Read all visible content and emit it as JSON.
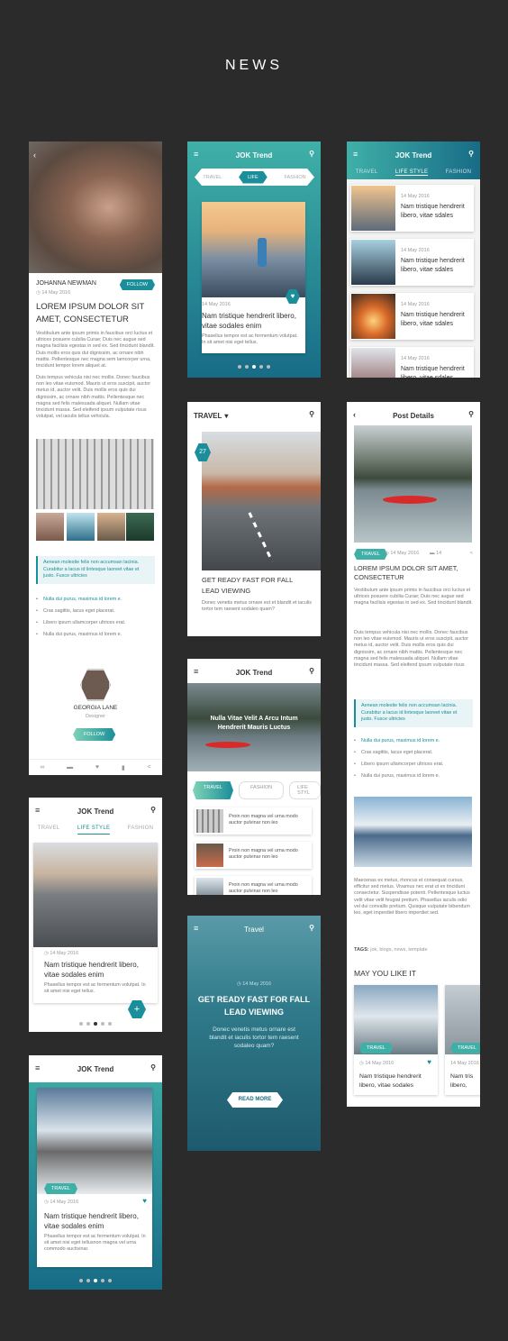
{
  "page": {
    "title": "NEWS"
  },
  "colors": {
    "accent": "#1a8e9a",
    "bg": "#2b2b2b"
  },
  "s1": {
    "author": "JOHANNA NEWMAN",
    "follow": "FOLLOW",
    "date": "14 May 2016",
    "title": "LOREM IPSUM DOLOR SIT AMET, CONSECTETUR",
    "p1": "Vestibulum ante ipsum primis in faucibus orci luctus et ultrices posuere cubilia Curae; Duis nec augue sed magna facilisis egestas in sed ex. Sed tincidunt blandit. Duis mollis eros quis dui dignissim, ac ornare nibh mattis. Pellentesque nec magna sem lamcorper urna, tincidunt tempor lorem aliquet at.",
    "p2": "Duis tempus vehicula nisi nec mollis. Donec faucibus non leo vitae euismod. Mauris ut eros suscipit, auctor metus id, auctor velit. Duis mollis eros quis dui dignissim, ac ornare nibh mattis. Pellentesque nec magna sed felis malesuada aliquet. Nullam vitae tincidunt massa. Sed eleifend ipsum vulputate risus volutpat, vel iaculis tellus vehicula.",
    "quote": "Aenean molestie felis non accumsan lacinia. Curabitur a lacus id lintesque laoreet vitae et justo. Fusce ultricies",
    "bullets": [
      "Nulla dui purus, maximus id lorem e.",
      "Cras sagittis, lacus eget placerat.",
      "Libero ipsum ullamcorper ultrices erat.",
      "Nulla dui purus, maximus id lorem e."
    ],
    "person": "GEORGIA LANE",
    "role": "Designer",
    "follow2": "FOLLOW"
  },
  "s2": {
    "title": "JOK Trend",
    "tabs": [
      "TRAVEL",
      "LIFE",
      "FASHION"
    ],
    "date": "14 May 2016",
    "headline": "Nam tristique hendrerit libero, vitae sodales enim",
    "body": "Phasellus tempor est ac fermentum volutpat. In sit amet nisi eget tellus."
  },
  "s3": {
    "title": "JOK Trend",
    "tabs": [
      "TRAVEL",
      "LIFE STYLE",
      "FASHION"
    ],
    "date": "14 May 2016",
    "headline": "Nam tristique hendrerit libero, vitae sdales"
  },
  "s4": {
    "title": "TRAVEL",
    "badge": "27",
    "headline": "GET READY FAST FOR FALL LEAD VIEWING",
    "body": "Donec venetis metus ornare est et blandit et iaculis tortor tem raesent sodaleo quam?"
  },
  "s5": {
    "title": "Post Details",
    "tag": "TRAVEL",
    "date": "14 May 2016",
    "comments": "14",
    "headline": "LOREM IPSUM DOLOR SIT AMET, CONSECTETUR",
    "p1": "Vestibulum ante ipsum primis in faucibus orci luctus et ultrices posuere cubilia Curae; Duis nec augue sed magna facilisis egestas in sed ex. Sed tincidunt blandit.",
    "p2": "Duis tempus vehicula nisi nec mollis. Donec faucibus non leo vitae euismod. Mauris ut eros suscipit, auctor metus id, auctor velit. Duis mollis eros quis dui dignissim, ac ornare nibh mattis. Pellentesque nec magna sed felis malesuada aliquet. Nullam vitae tincidunt massa. Sed eleifend ipsum vulputate risus",
    "quote": "Aenean molestie felis non accumsan lacinia. Curabitur a lacus id lintesque laoreet vitae et justo. Fusce ultricies",
    "bullets": [
      "Nulla dui purus, maximus id lorem e.",
      "Cras sagittis, lacus eget placerat.",
      "Libero ipsum ullamcorper ultrices erat.",
      "Nulla dui purus, maximus id lorem e."
    ],
    "p3": "Maecenas ex metus, rhoncus et consequat cursus, efficitur sed metus. Vivamus nec erat ut ex tincidunt consectetur. Suspendisse potenti. Pellentesque luctus velit vitae velit feugiat pretium. Phasellus iaculis odio vel dui convallis pretium. Quisque vulputate bibendum leo, eget imperdiet libero imperdiet sed.",
    "tags_label": "TAGS:",
    "tags": "jok, blogs, news, template",
    "may": "MAY YOU LIKE IT",
    "cardtag": "TRAVEL",
    "carddate": "14 May 2016",
    "cardtitle": "Nam tristique hendrerit libero, vitae sodales",
    "cardtitle2": "Nam tris libero,"
  },
  "s6": {
    "title": "JOK Trend",
    "tabs": [
      "TRAVEL",
      "LIFE STYLE",
      "FASHION"
    ],
    "date": "14 May 2016",
    "headline": "Nam tristique hendrerit libero, vitae sodales enim",
    "body": "Phasellus tempor est ac fermentum volutpat. In sit amet nisi eget tellus."
  },
  "s7": {
    "title": "JOK Trend",
    "hero": "Nulla Vitae Velit A Arcu Intum Hendrerit Mauris Luctus",
    "tabs": [
      "TRAVEL",
      "FASHION",
      "LIFE STYL"
    ],
    "item": "Proin non magna vel urna modo auctor pulvinar non leo"
  },
  "s8": {
    "title": "Travel",
    "date": "14 May 2016",
    "headline": "GET READY FAST FOR FALL LEAD VIEWING",
    "body": "Donec venetis metus ornare est blandit et iaculis tortor tem raesent sodaleo quam?",
    "button": "READ MORE"
  },
  "s9": {
    "title": "JOK Trend",
    "tag": "TRAVEL",
    "date": "14 May 2016",
    "headline": "Nam tristique hendrerit libero, vitae sodales enim",
    "body": "Phasellus tempor est ac fermentum volutpat. In sit amet nisi eget tellusnon magna vel urna commodo auctivinar."
  }
}
